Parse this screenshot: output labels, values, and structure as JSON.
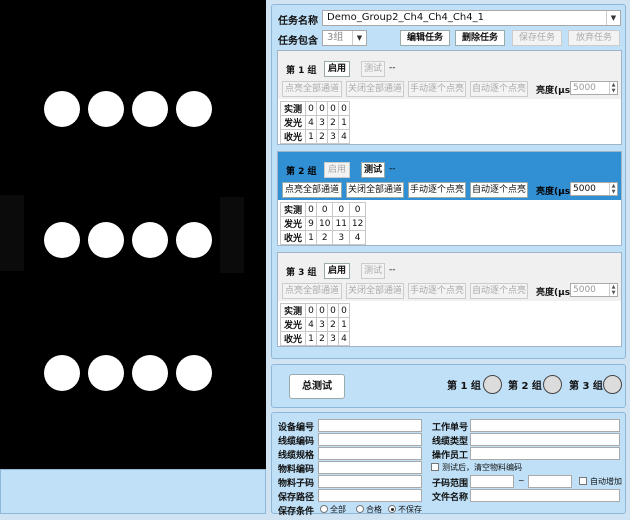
{
  "task": {
    "name_label": "任务名称",
    "name_value": "Demo_Group2_Ch4_Ch4_Ch4_1",
    "contains_label": "任务包含",
    "contains_value": "3组",
    "edit_label": "编辑任务",
    "delete_label": "删除任务",
    "save_label": "保存任务",
    "discard_label": "放弃任务"
  },
  "groups": [
    {
      "title": "第 1 组",
      "enable": "启用",
      "test": "测试",
      "dash": "--",
      "all_on": "点亮全部通道",
      "all_off": "关闭全部通道",
      "manual": "手动逐个点亮",
      "auto": "自动逐个点亮",
      "lum_label": "亮度(µs)",
      "lum_value": "5000",
      "rows": [
        {
          "label": "实测",
          "cells": [
            "0",
            "0",
            "0",
            "0"
          ]
        },
        {
          "label": "发光",
          "cells": [
            "4",
            "3",
            "2",
            "1"
          ]
        },
        {
          "label": "收光",
          "cells": [
            "1",
            "2",
            "3",
            "4"
          ]
        }
      ]
    },
    {
      "title": "第 2 组",
      "enable": "启用",
      "test": "测试",
      "dash": "--",
      "all_on": "点亮全部通道",
      "all_off": "关闭全部通道",
      "manual": "手动逐个点亮",
      "auto": "自动逐个点亮",
      "lum_label": "亮度(µs)",
      "lum_value": "5000",
      "rows": [
        {
          "label": "实测",
          "cells": [
            "0",
            "0",
            "0",
            "0"
          ]
        },
        {
          "label": "发光",
          "cells": [
            "9",
            "10",
            "11",
            "12"
          ]
        },
        {
          "label": "收光",
          "cells": [
            "1",
            "2",
            "3",
            "4"
          ]
        }
      ]
    },
    {
      "title": "第 3 组",
      "enable": "启用",
      "test": "测试",
      "dash": "--",
      "all_on": "点亮全部通道",
      "all_off": "关闭全部通道",
      "manual": "手动逐个点亮",
      "auto": "自动逐个点亮",
      "lum_label": "亮度(µs)",
      "lum_value": "5000",
      "rows": [
        {
          "label": "实测",
          "cells": [
            "0",
            "0",
            "0",
            "0"
          ]
        },
        {
          "label": "发光",
          "cells": [
            "4",
            "3",
            "2",
            "1"
          ]
        },
        {
          "label": "收光",
          "cells": [
            "1",
            "2",
            "3",
            "4"
          ]
        }
      ]
    }
  ],
  "test": {
    "total_label": "总测试",
    "g1": "第 1 组",
    "g2": "第 2 组",
    "g3": "第 3 组"
  },
  "info": {
    "device_no": "设备编号",
    "cable_code": "线缆编码",
    "cable_spec": "线缆规格",
    "material_code": "物料编码",
    "material_sub": "物料子码",
    "save_path": "保存路径",
    "save_cond": "保存条件",
    "opt_all": "全部",
    "opt_pass": "合格",
    "opt_none": "不保存",
    "work_order": "工作单号",
    "cable_type": "线缆类型",
    "operator": "操作员工",
    "clear_after": "测试后，清空物料编码",
    "sub_range": "子码范围",
    "tilde": "~",
    "auto_inc": "自动增加",
    "file_name": "文件名称"
  },
  "colors": {
    "active_group": "#3190d4",
    "panel_bg": "#bfe0f7",
    "preview_bg": "#000000"
  }
}
